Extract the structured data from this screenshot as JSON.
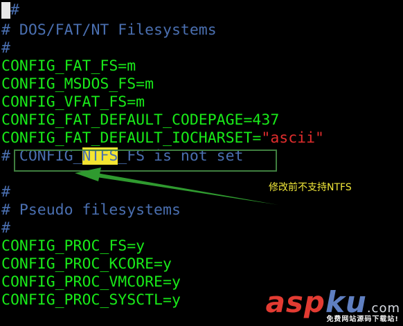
{
  "terminal": {
    "lines": [
      "#",
      "# DOS/FAT/NT Filesystems",
      "#",
      "CONFIG_FAT_FS=m",
      "CONFIG_MSDOS_FS=m",
      "CONFIG_VFAT_FS=m",
      "CONFIG_FAT_DEFAULT_CODEPAGE=437",
      "CONFIG_FAT_DEFAULT_IOCHARSET=",
      "\"ascii\"",
      "# CONFIG_",
      "NTFS",
      "_FS is not set",
      "#",
      "# Pseudo filesystems",
      "#",
      "CONFIG_PROC_FS=y",
      "CONFIG_PROC_KCORE=y",
      "CONFIG_PROC_VMCORE=y",
      "CONFIG_PROC_SYSCTL=y"
    ]
  },
  "annotation": {
    "text": "修改前不支持NTFS",
    "box_color": "#3f7f3f",
    "text_color": "#f1e83a"
  },
  "watermark": {
    "logo_part1": "asp",
    "logo_part2": "ku",
    "logo_part3": ".com",
    "subtitle": "免费网站源码下载站!"
  },
  "colors": {
    "background": "#000000",
    "comment": "#4a6fb0",
    "config": "#19ea19",
    "string": "#e12d2d",
    "highlight": "#f4e531"
  }
}
